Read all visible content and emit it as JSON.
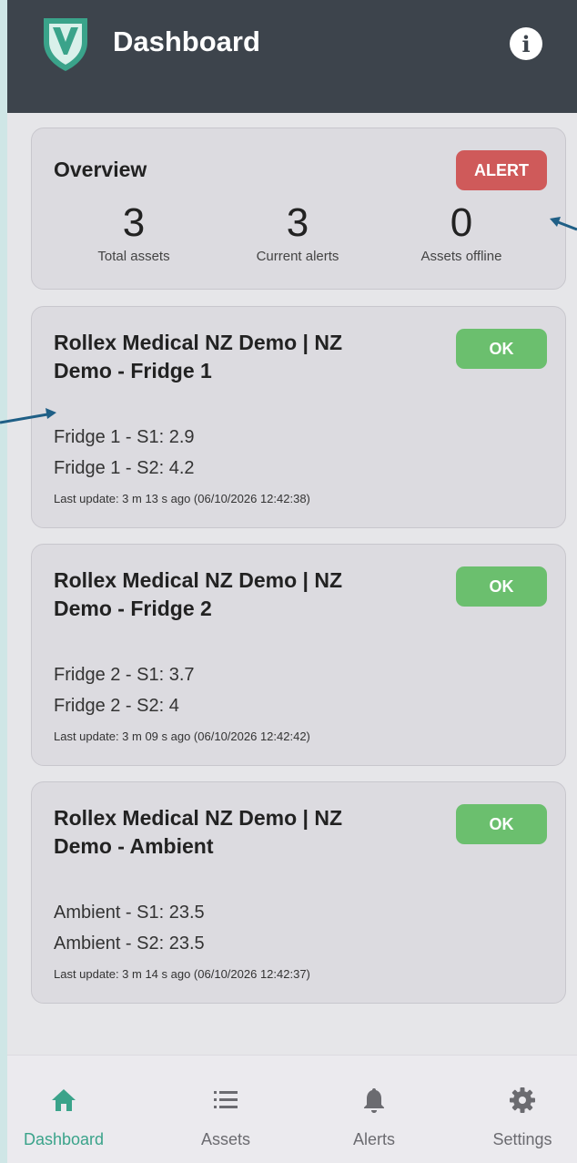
{
  "header": {
    "title": "Dashboard"
  },
  "overview": {
    "title": "Overview",
    "status": "ALERT",
    "stats": [
      {
        "value": "3",
        "label": "Total assets"
      },
      {
        "value": "3",
        "label": "Current alerts"
      },
      {
        "value": "0",
        "label": "Assets offline"
      }
    ]
  },
  "assets": [
    {
      "title": "Rollex Medical NZ Demo | NZ Demo - Fridge 1",
      "status": "OK",
      "reading1": "Fridge 1 - S1: 2.9",
      "reading2": "Fridge 1 - S2: 4.2",
      "updated": "Last update: 3 m 13 s ago (06/10/2026 12:42:38)"
    },
    {
      "title": "Rollex Medical NZ Demo | NZ Demo - Fridge 2",
      "status": "OK",
      "reading1": "Fridge 2 - S1: 3.7",
      "reading2": "Fridge 2 - S2: 4",
      "updated": "Last update: 3 m 09 s ago (06/10/2026 12:42:42)"
    },
    {
      "title": "Rollex Medical NZ Demo | NZ Demo - Ambient",
      "status": "OK",
      "reading1": "Ambient - S1: 23.5",
      "reading2": "Ambient - S2: 23.5",
      "updated": "Last update: 3 m 14 s ago (06/10/2026 12:42:37)"
    }
  ],
  "nav": [
    {
      "label": "Dashboard",
      "icon": "home-icon",
      "active": true
    },
    {
      "label": "Assets",
      "icon": "list-icon",
      "active": false
    },
    {
      "label": "Alerts",
      "icon": "bell-icon",
      "active": false
    },
    {
      "label": "Settings",
      "icon": "gear-icon",
      "active": false
    }
  ],
  "colors": {
    "header": "#3d444c",
    "alert": "#cf5a5a",
    "ok": "#6bbf6e",
    "accent": "#3aa38a"
  }
}
